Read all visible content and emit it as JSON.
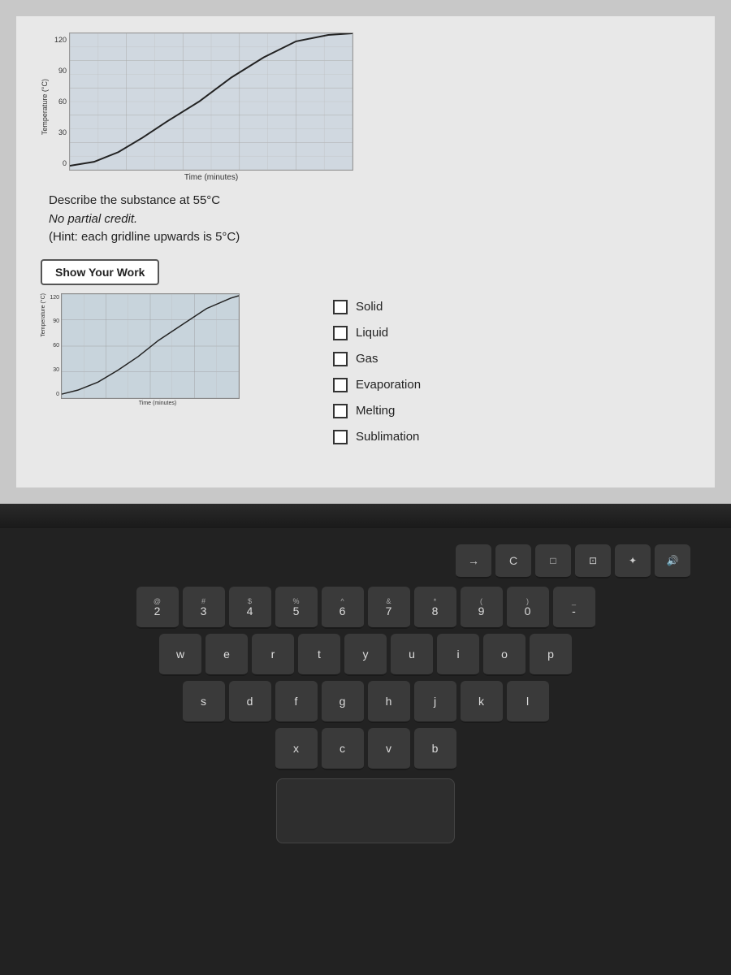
{
  "screen": {
    "background": "#e0e0e0"
  },
  "chart": {
    "y_axis_label": "Temperature (°C)",
    "x_axis_label": "Time (minutes)",
    "y_values": [
      "120",
      "90",
      "60",
      "30"
    ],
    "line_description": "Rising temperature line"
  },
  "question": {
    "line1": "Describe the substance at 55°C",
    "line2": "No partial credit.",
    "line3": "(Hint: each gridline upwards is 5°C)"
  },
  "show_work_button": {
    "label": "Show Your Work"
  },
  "mini_chart": {
    "x_axis_label": "Time (minutes)",
    "y_axis_label": "Temperature (°C)"
  },
  "options": [
    {
      "id": "solid",
      "label": "Solid",
      "checked": false
    },
    {
      "id": "liquid",
      "label": "Liquid",
      "checked": false
    },
    {
      "id": "gas",
      "label": "Gas",
      "checked": false
    },
    {
      "id": "evaporation",
      "label": "Evaporation",
      "checked": false
    },
    {
      "id": "melting",
      "label": "Melting",
      "checked": false
    },
    {
      "id": "sublimation",
      "label": "Sublimation",
      "checked": false
    }
  ],
  "keyboard": {
    "rows": [
      {
        "keys": [
          {
            "top": "",
            "main": "→",
            "wide": false
          },
          {
            "top": "",
            "main": "C",
            "wide": false
          },
          {
            "top": "",
            "main": "□",
            "wide": false
          },
          {
            "top": "",
            "main": "◫",
            "wide": false
          },
          {
            "top": "",
            "main": "◎",
            "wide": false
          },
          {
            "top": "",
            "main": "✦",
            "wide": false
          },
          {
            "top": "",
            "main": "🔊",
            "wide": false
          }
        ]
      },
      {
        "keys": [
          {
            "top": "@",
            "main": "2",
            "wide": false
          },
          {
            "top": "#",
            "main": "3",
            "wide": false
          },
          {
            "top": "$",
            "main": "4",
            "wide": false
          },
          {
            "top": "%",
            "main": "5",
            "wide": false
          },
          {
            "top": "^",
            "main": "6",
            "wide": false
          },
          {
            "top": "&",
            "main": "7",
            "wide": false
          },
          {
            "top": "*",
            "main": "8",
            "wide": false
          },
          {
            "top": "(",
            "main": "9",
            "wide": false
          },
          {
            "top": ")",
            "main": "0",
            "wide": false
          },
          {
            "top": "_",
            "main": "-",
            "wide": false
          }
        ]
      },
      {
        "keys": [
          {
            "top": "",
            "main": "w",
            "wide": false
          },
          {
            "top": "",
            "main": "e",
            "wide": false
          },
          {
            "top": "",
            "main": "r",
            "wide": false
          },
          {
            "top": "",
            "main": "t",
            "wide": false
          },
          {
            "top": "",
            "main": "y",
            "wide": false
          },
          {
            "top": "",
            "main": "u",
            "wide": false
          },
          {
            "top": "",
            "main": "i",
            "wide": false
          },
          {
            "top": "",
            "main": "o",
            "wide": false
          },
          {
            "top": "",
            "main": "p",
            "wide": false
          }
        ]
      },
      {
        "keys": [
          {
            "top": "",
            "main": "s",
            "wide": false
          },
          {
            "top": "",
            "main": "d",
            "wide": false
          },
          {
            "top": "",
            "main": "f",
            "wide": false
          },
          {
            "top": "",
            "main": "g",
            "wide": false
          },
          {
            "top": "",
            "main": "h",
            "wide": false
          },
          {
            "top": "",
            "main": "j",
            "wide": false
          },
          {
            "top": "",
            "main": "k",
            "wide": false
          },
          {
            "top": "",
            "main": "l",
            "wide": false
          }
        ]
      },
      {
        "keys": [
          {
            "top": "",
            "main": "x",
            "wide": false
          },
          {
            "top": "",
            "main": "c",
            "wide": false
          },
          {
            "top": "",
            "main": "v",
            "wide": false
          },
          {
            "top": "",
            "main": "b",
            "wide": false
          }
        ]
      }
    ]
  }
}
